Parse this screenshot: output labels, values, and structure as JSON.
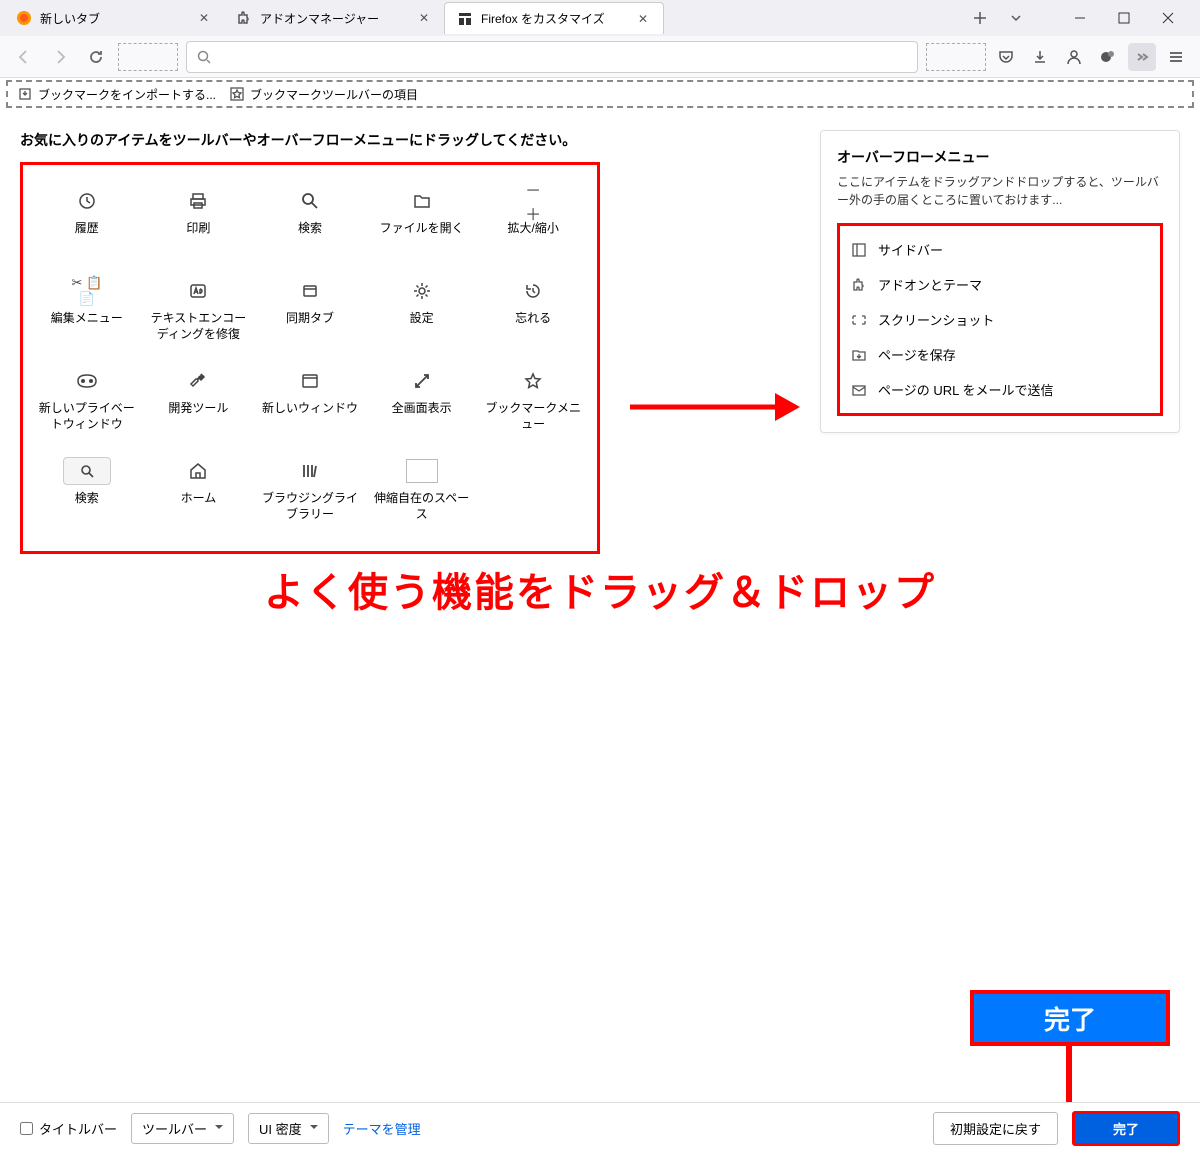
{
  "tabs": [
    {
      "title": "新しいタブ"
    },
    {
      "title": "アドオンマネージャー"
    },
    {
      "title": "Firefox をカスタマイズ"
    }
  ],
  "bookmarkbar": {
    "import": "ブックマークをインポートする...",
    "items": "ブックマークツールバーの項目"
  },
  "instruction": "お気に入りのアイテムをツールバーやオーバーフローメニューにドラッグしてください。",
  "palette": [
    {
      "label": "履歴",
      "icon": "history"
    },
    {
      "label": "印刷",
      "icon": "print"
    },
    {
      "label": "検索",
      "icon": "search"
    },
    {
      "label": "ファイルを開く",
      "icon": "open-file"
    },
    {
      "label": "拡大/縮小",
      "icon": "zoom"
    },
    {
      "label": "編集メニュー",
      "icon": "edit-menu"
    },
    {
      "label": "テキストエンコーディングを修復",
      "icon": "encoding"
    },
    {
      "label": "同期タブ",
      "icon": "sync-tab"
    },
    {
      "label": "設定",
      "icon": "settings"
    },
    {
      "label": "忘れる",
      "icon": "forget"
    },
    {
      "label": "新しいプライベートウィンドウ",
      "icon": "private"
    },
    {
      "label": "開発ツール",
      "icon": "devtools"
    },
    {
      "label": "新しいウィンドウ",
      "icon": "new-window"
    },
    {
      "label": "全画面表示",
      "icon": "fullscreen"
    },
    {
      "label": "ブックマークメニュー",
      "icon": "bookmark-menu"
    },
    {
      "label": "検索",
      "icon": "search-box"
    },
    {
      "label": "ホーム",
      "icon": "home"
    },
    {
      "label": "ブラウジングライブラリー",
      "icon": "library"
    },
    {
      "label": "伸縮自在のスペース",
      "icon": "flex-space"
    }
  ],
  "overflow": {
    "title": "オーバーフローメニュー",
    "desc": "ここにアイテムをドラッグアンドドロップすると、ツールバー外の手の届くところに置いておけます...",
    "items": [
      {
        "label": "サイドバー",
        "icon": "sidebar"
      },
      {
        "label": "アドオンとテーマ",
        "icon": "addons"
      },
      {
        "label": "スクリーンショット",
        "icon": "screenshot"
      },
      {
        "label": "ページを保存",
        "icon": "save-page"
      },
      {
        "label": "ページの URL をメールで送信",
        "icon": "email-link"
      }
    ]
  },
  "annotation": "よく使う機能をドラッグ＆ドロップ",
  "big_done": "完了",
  "footer": {
    "titlebar": "タイトルバー",
    "toolbars": "ツールバー",
    "density": "UI 密度",
    "themes": "テーマを管理",
    "restore": "初期設定に戻す",
    "done": "完了"
  }
}
